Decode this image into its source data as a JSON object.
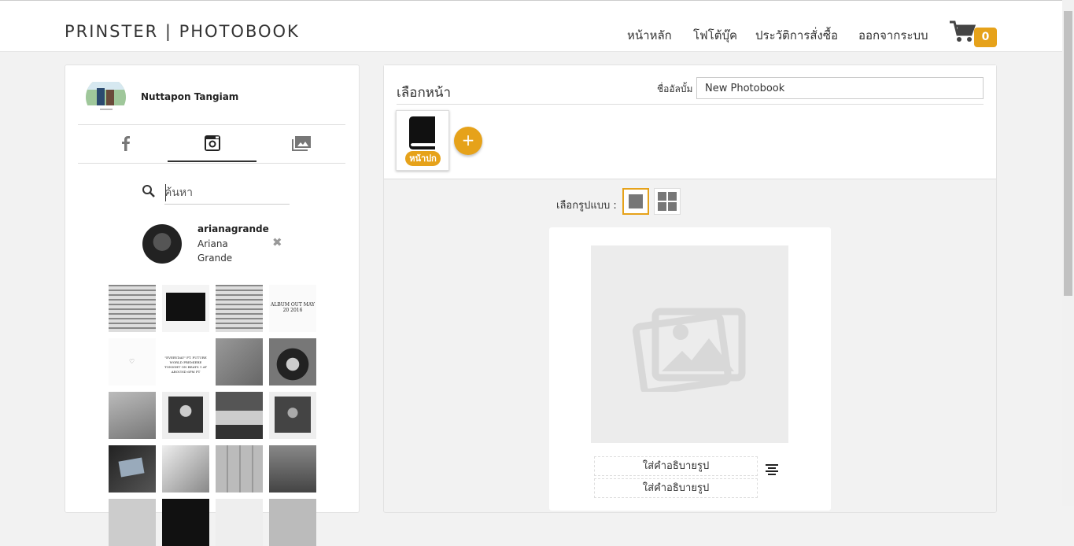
{
  "header": {
    "brand": "PRINSTER | PHOTOBOOK",
    "nav": [
      "หน้าหลัก",
      "โฟโต้บุ๊ค",
      "ประวัติการสั่งซื้อ",
      "ออกจากระบบ"
    ],
    "cart_count": "0",
    "accent": "#e6a21a"
  },
  "sidebar": {
    "user_name": "Nuttapon Tangiam",
    "tabs": [
      "facebook-icon",
      "instagram-icon",
      "gallery-icon"
    ],
    "active_tab": "instagram-icon",
    "search": {
      "placeholder": "ค้นหา",
      "value": ""
    },
    "ig_account": {
      "username": "arianagrande",
      "display_name": "Ariana Grande"
    },
    "thumb_texts": [
      "ALBUM OUT MAY 20 2016",
      "\"EVERYDAY\" FT. FUTURE WORLD PREMIERE TONIGHT ON BEATS 1 AT AROUND 6PM PT"
    ]
  },
  "editor": {
    "select_page_label": "เลือกหน้า",
    "album_name_label": "ชื่ออัลบั้ม",
    "album_name_value": "New Photobook",
    "cover_label": "หน้าปก",
    "add_label": "+",
    "layout_label": "เลือกรูปแบบ :",
    "caption_placeholder": "ใส่คำอธิบายรูป",
    "captions": [
      "ใส่คำอธิบายรูป",
      "ใส่คำอธิบายรูป"
    ]
  }
}
